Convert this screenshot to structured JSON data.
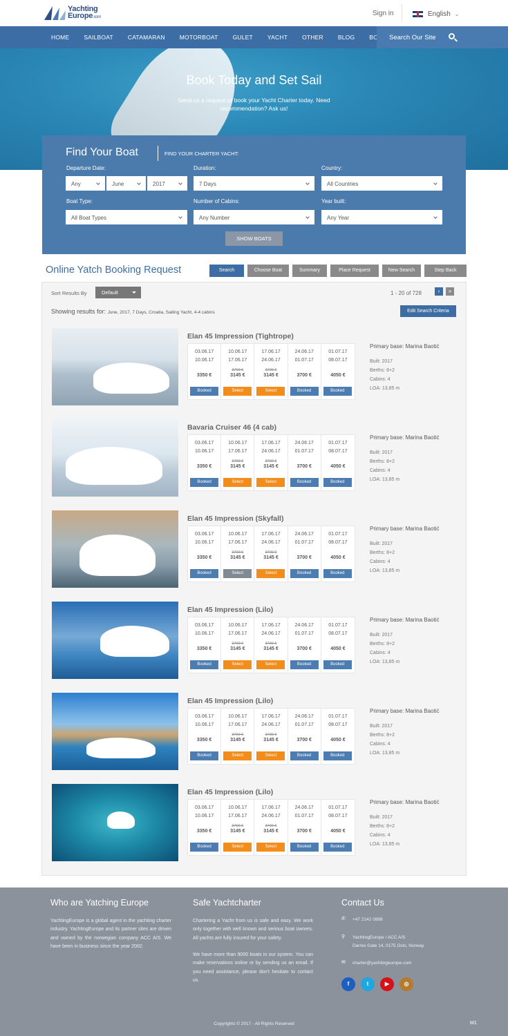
{
  "header": {
    "logo_name": "Yachting",
    "logo_name2": "Europe",
    "logo_suffix": ".com",
    "signin": "Sign in",
    "language": "English"
  },
  "nav": {
    "items": [
      "HOME",
      "SAILBOAT",
      "CATAMARAN",
      "MOTORBOAT",
      "GULET",
      "YACHT",
      "OTHER",
      "BLOG",
      "BOOKING"
    ],
    "search_label": "Search Our Site"
  },
  "hero": {
    "title": "Book Today and Set Sail",
    "subtitle": "Send us a request or book your Yacht Charter today. Need recommendation? Ask us!"
  },
  "finder": {
    "title": "Find Your Boat",
    "subtitle": "FIND YOUR CHARTER YACHT:",
    "departure_label": "Departure Date:",
    "day": "Any",
    "month": "June",
    "year": "2017",
    "duration_label": "Duration:",
    "duration": "7 Days",
    "country_label": "Country:",
    "country": "All Countries",
    "boattype_label": "Boat Type:",
    "boattype": "All Boat Types",
    "cabins_label": "Number of Cabins:",
    "cabins": "Any Number",
    "yearbuilt_label": "Year built:",
    "yearbuilt": "Any Year",
    "show_button": "SHOW BOATS"
  },
  "booking": {
    "title": "Online Yatch Booking Request",
    "steps": [
      "Search",
      "Choose Boat",
      "Summary",
      "Place Request",
      "New Search",
      "Step Back"
    ]
  },
  "results": {
    "sort_label": "Sort Results By",
    "sort_value": "Default",
    "pager_range": "1 - 20",
    "pager_of": "of",
    "pager_total": "728",
    "showing_label": "Showing results for:",
    "showing_criteria": "June, 2017, 7 Days, Croatia, Sailing Yacht, 4-4 cabins",
    "edit_button": "Edit Search Criteria",
    "listings": [
      {
        "title": "Elan 45 Impression (Tightrope)",
        "buttons": [
          "Booked",
          "Select",
          "Select",
          "Booked",
          "Booked"
        ]
      },
      {
        "title": "Bavaria Cruiser 46 (4 cab)",
        "buttons": [
          "Booked",
          "Select",
          "Select",
          "Booked",
          "Booked"
        ]
      },
      {
        "title": "Elan 45 Impression (Skyfall)",
        "buttons": [
          "Booked",
          "Select",
          "Select",
          "Booked",
          "Booked"
        ]
      },
      {
        "title": "Elan 45 Impression (Lilo)",
        "buttons": [
          "Booked",
          "Select",
          "Select",
          "Booked",
          "Booked"
        ]
      },
      {
        "title": "Elan 45 Impression (Lilo)",
        "buttons": [
          "Booked",
          "Select",
          "Select",
          "Booked",
          "Booked"
        ]
      },
      {
        "title": "Elan 45 Impression (Lilo)",
        "buttons": [
          "Booked",
          "Select",
          "Select",
          "Booked",
          "Booked"
        ]
      }
    ],
    "periods": [
      {
        "from": "03.06.17",
        "to": "10.06.17",
        "old": "",
        "price": "3350 €"
      },
      {
        "from": "10.06.17",
        "to": "17.06.17",
        "old": "3700 €",
        "price": "3145 €"
      },
      {
        "from": "17.06.17",
        "to": "24.06.17",
        "old": "3700 €",
        "price": "3145 €"
      },
      {
        "from": "24.06.17",
        "to": "01.07.17",
        "old": "",
        "price": "3700 €"
      },
      {
        "from": "01.07.17",
        "to": "08.07.17",
        "old": "",
        "price": "4050 €"
      }
    ],
    "info": {
      "base": "Primary base: Marina Baotić",
      "built": "Built: 2017",
      "berths": "Berths: 8+2",
      "cabins": "Cabins: 4",
      "loa": "LOA: 13,85 m"
    }
  },
  "footer": {
    "about_title": "Who are Yatching Europe",
    "about_text": "YachtingEurope is a global agent in the yachting charter industry. YachtingEurope and its partner sites are driven and owned by the norwegian company ACC A/S. We have been in business since the year 2002.",
    "safe_title": "Safe Yachtcharter",
    "safe_text1": "Chartering a Yacht from us is safe and easy. We work only together with well known and serious boat owners. All yachts are fully insured for your safety.",
    "safe_text2": "We have more than 9000 boats in our system. You can make reservations online or by sending us an email. If you need assistance, please don't hesitate to contact us.",
    "contact_title": "Contact Us",
    "phone": "+47 2142 0888",
    "address1": "YachtingEurope / ACC A/S",
    "address2": "Darres Gate 14, 0175 Oslo, Norway",
    "email": "charter@yachtingeurope.com",
    "copyright": "Copyrights © 2017 - All Rights Reserved",
    "badge": "M1",
    "colors": {
      "facebook": "#1d5fbf",
      "twitter": "#1fa7e0",
      "youtube": "#d4121b",
      "instagram": "#b57a2e"
    }
  }
}
